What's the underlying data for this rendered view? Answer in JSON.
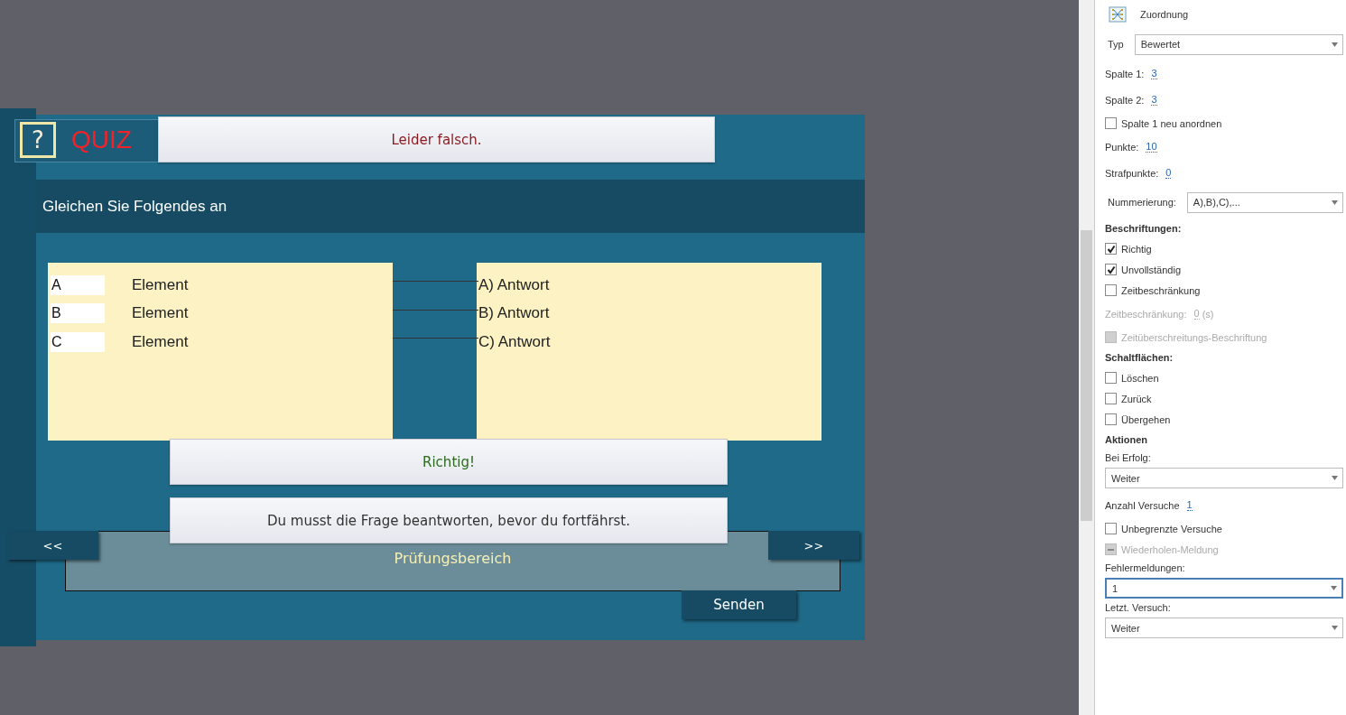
{
  "slide": {
    "icon_glyph": "?",
    "title": "QUIZ",
    "question": "Gleichen Sie Folgendes an",
    "column_1": [
      {
        "letter": "A",
        "label": "Element"
      },
      {
        "letter": "B",
        "label": "Element"
      },
      {
        "letter": "C",
        "label": "Element"
      }
    ],
    "column_2": [
      "A) Antwort",
      "B) Antwort",
      "C) Antwort"
    ],
    "captions": [
      {
        "kind": "failure",
        "text": "Leider falsch."
      },
      {
        "kind": "success",
        "text": "Richtig!"
      },
      {
        "kind": "incomplete",
        "text": "Du musst die Frage beantworten, bevor du fortfährst."
      }
    ],
    "review_area": "Prüfungsbereich",
    "prev_button": "<<",
    "next_button": ">>",
    "submit_button": "Senden"
  },
  "panel": {
    "title": "Zuordnung",
    "rows": [
      {
        "kind": "combo",
        "label": "Typ",
        "value": "Bewertet",
        "focused": false
      },
      {
        "kind": "value",
        "label": "Spalte 1:",
        "value": "3",
        "disabled": false
      },
      {
        "kind": "value",
        "label": "Spalte 2:",
        "value": "3",
        "disabled": false
      },
      {
        "kind": "checkbox",
        "label": "Spalte 1 neu anordnen",
        "checked": false,
        "disabled": false
      },
      {
        "kind": "value",
        "label": "Punkte:",
        "value": "10",
        "disabled": false
      },
      {
        "kind": "value",
        "label": "Strafpunkte:",
        "value": "0",
        "disabled": false
      },
      {
        "kind": "combo",
        "label": "Nummerierung:",
        "value": "A),B),C),...",
        "focused": false
      },
      {
        "kind": "divider"
      },
      {
        "kind": "heading",
        "label": "Beschriftungen:"
      },
      {
        "kind": "checkbox",
        "label": "Richtig",
        "checked": true,
        "disabled": false
      },
      {
        "kind": "checkbox",
        "label": "Unvollständig",
        "checked": true,
        "disabled": false
      },
      {
        "kind": "checkbox",
        "label": "Zeitbeschränkung",
        "checked": false,
        "disabled": false
      },
      {
        "kind": "value",
        "label": "Zeitbeschränkung:",
        "value": "0",
        "unit": "(s)",
        "disabled": true
      },
      {
        "kind": "checkbox",
        "label": "Zeitüberschreitungs-Beschriftung",
        "checked": false,
        "disabled": true
      },
      {
        "kind": "heading",
        "label": "Schaltflächen:"
      },
      {
        "kind": "checkbox",
        "label": "Löschen",
        "checked": false,
        "disabled": false
      },
      {
        "kind": "checkbox",
        "label": "Zurück",
        "checked": false,
        "disabled": false
      },
      {
        "kind": "checkbox",
        "label": "Übergehen",
        "checked": false,
        "disabled": false
      },
      {
        "kind": "divider"
      },
      {
        "kind": "heading",
        "label": "Aktionen"
      },
      {
        "kind": "select",
        "label": "Bei Erfolg:",
        "value": "Weiter",
        "focused": false
      },
      {
        "kind": "value",
        "label": "Anzahl Versuche",
        "value": "1",
        "disabled": false
      },
      {
        "kind": "checkbox",
        "label": "Unbegrenzte Versuche",
        "checked": false,
        "disabled": false
      },
      {
        "kind": "checkbox",
        "label": "Wiederholen-Meldung",
        "checked": true,
        "disabled": true
      },
      {
        "kind": "select",
        "label": "Fehlermeldungen:",
        "value": "1",
        "focused": true
      },
      {
        "kind": "select",
        "label": "Letzt. Versuch:",
        "value": "Weiter",
        "focused": false
      }
    ]
  }
}
